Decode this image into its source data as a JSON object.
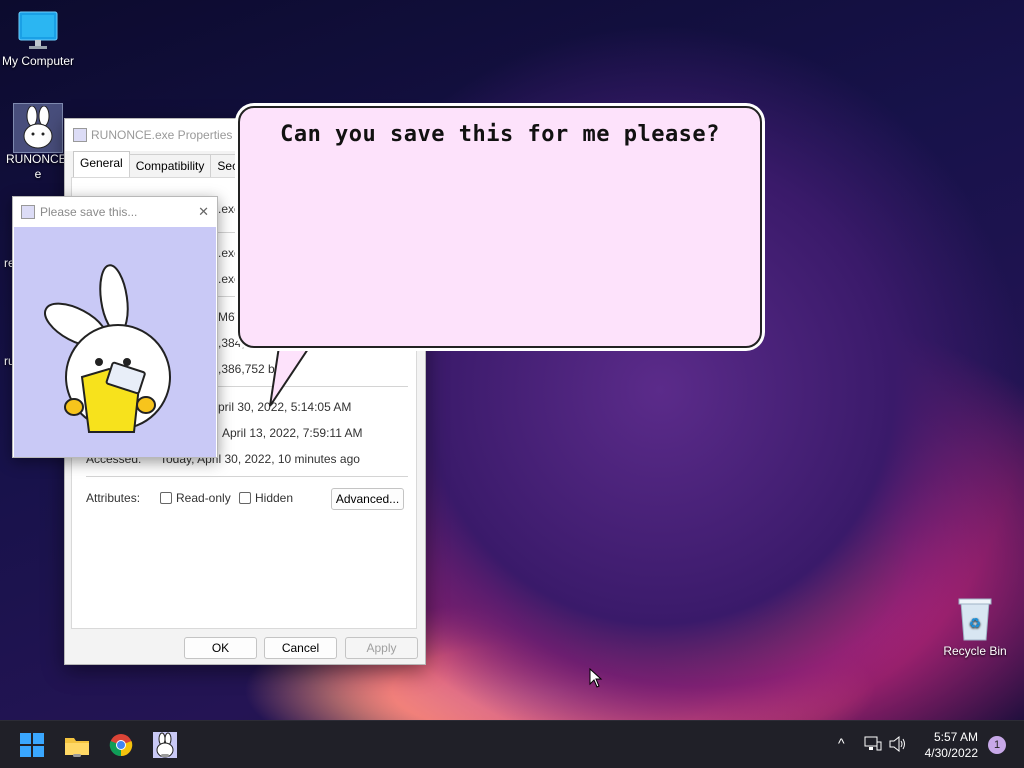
{
  "desktop": {
    "icons": [
      {
        "name": "my-computer-icon",
        "label": "My Computer"
      },
      {
        "name": "runonce-icon",
        "label_line1": "RUNONCE.",
        "label_line2": "e"
      },
      {
        "name": "recycle-bin-icon",
        "label": "Recycle Bin"
      }
    ],
    "partial_labels": [
      "re",
      "ru"
    ]
  },
  "properties_window": {
    "title": "RUNONCE.exe Properties",
    "tabs": [
      "General",
      "Compatibility",
      "Security"
    ],
    "partial_rows": [
      ".exe",
      ".exe",
      ".exe",
      "M6\\[",
      ",384,",
      ",386,752 b"
    ],
    "created_value": "pril 30, 2022, 5:14:05 AM",
    "modified_value": "April 13, 2022, 7:59:11 AM",
    "accessed_label": "Accessed:",
    "accessed_value": "Today, April 30, 2022, 10 minutes ago",
    "attributes_label": "Attributes:",
    "readonly_label": "Read-only",
    "hidden_label": "Hidden",
    "advanced_label": "Advanced...",
    "ok_label": "OK",
    "cancel_label": "Cancel",
    "apply_label": "Apply"
  },
  "popup": {
    "title": "Please save this...",
    "close": "✕"
  },
  "bubble": {
    "text": "Can you save this for me please?"
  },
  "taskbar": {
    "time": "5:57 AM",
    "date": "4/30/2022",
    "notification_count": "1",
    "tray_chevron": "^"
  },
  "colors": {
    "bubble_fill": "#fde2fb",
    "popup_bg": "#c9c9f6",
    "folder_yellow": "#f7e21c",
    "taskbar_bg": "#202028"
  }
}
